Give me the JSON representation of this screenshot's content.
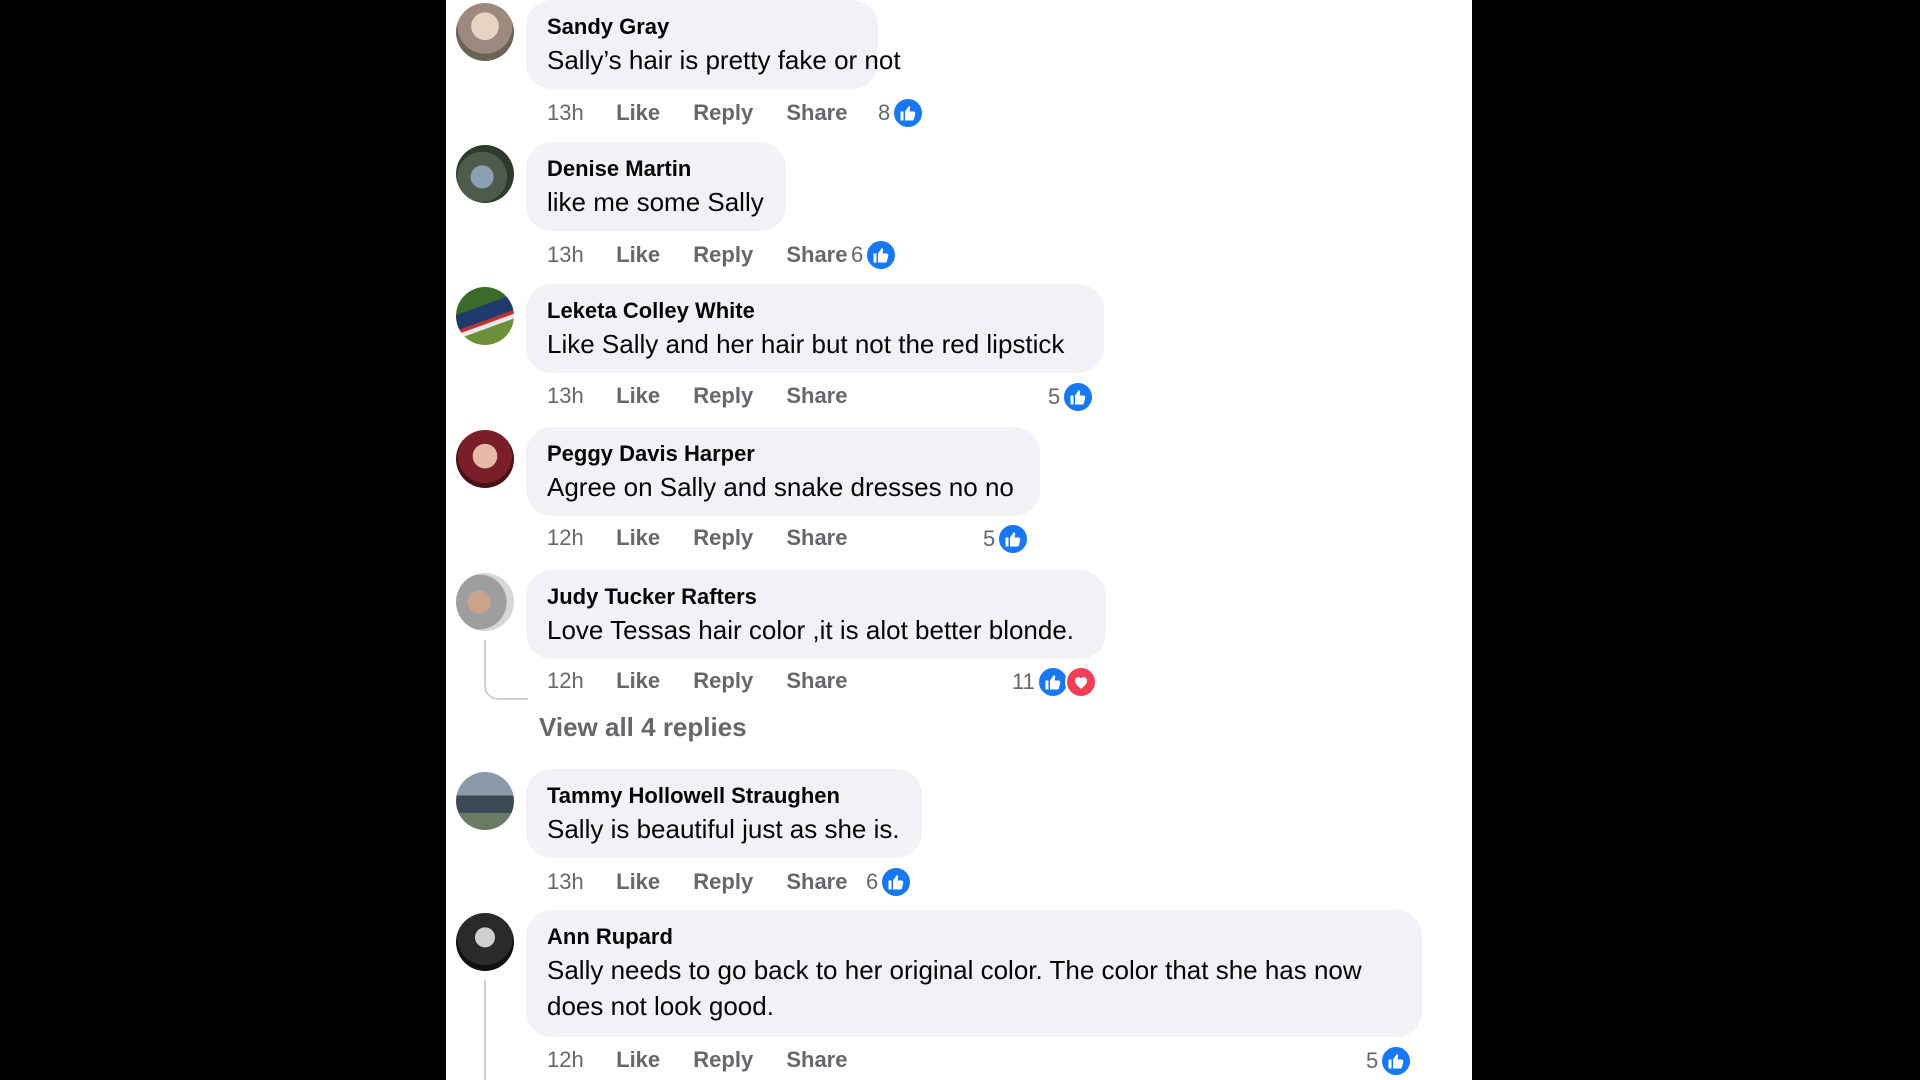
{
  "comments": [
    {
      "author": "Sandy Gray",
      "text": "Sally’s hair is pretty fake or not",
      "time": "13h",
      "reactions": "8"
    },
    {
      "author": "Denise Martin",
      "text": "like me some Sally",
      "time": "13h",
      "reactions": "6"
    },
    {
      "author": "Leketa Colley White",
      "text": "Like Sally and her hair but not the red lipstick",
      "time": "13h",
      "reactions": "5"
    },
    {
      "author": "Peggy Davis Harper",
      "text": "Agree on Sally and snake dresses no no",
      "time": "12h",
      "reactions": "5"
    },
    {
      "author": "Judy Tucker Rafters",
      "text": "Love Tessas hair color ,it is alot better blonde.",
      "time": "12h",
      "reactions": "11"
    },
    {
      "author": "Tammy Hollowell Straughen",
      "text": "Sally is beautiful just as she is.",
      "time": "13h",
      "reactions": "6"
    },
    {
      "author": "Ann Rupard",
      "text": "Sally needs to go back to her original color. The color that she has now does not look good.",
      "time": "12h",
      "reactions": "5"
    }
  ],
  "actions": {
    "like": "Like",
    "reply": "Reply",
    "share": "Share"
  },
  "view_replies": "View all 4 replies",
  "reaction_icons": [
    "like-icon",
    "love-icon"
  ],
  "colors": {
    "like_blue": "#1877f2",
    "love_red": "#f33e58",
    "bubble_bg": "#f0f2f5",
    "meta_gray": "#65676b"
  }
}
